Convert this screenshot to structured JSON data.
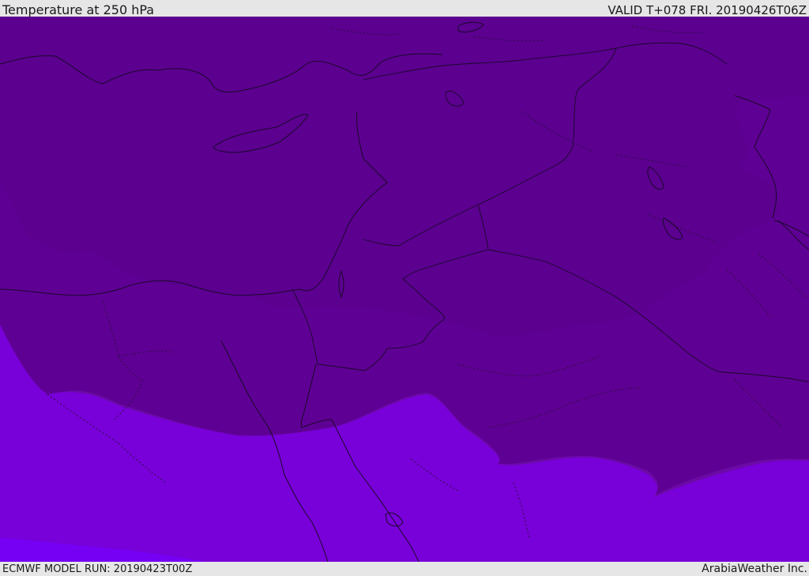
{
  "header": {
    "title": "Temperature at 250 hPa",
    "valid": "VALID T+078 FRI. 20190426T06Z"
  },
  "footer": {
    "model_run": "ECMWF MODEL RUN: 20190423T00Z",
    "credit": "ArabiaWeather Inc."
  },
  "map": {
    "field": "temperature",
    "level": "250 hPa",
    "color_bands": [
      "#520078",
      "#5f0094",
      "#6b0aa6",
      "#7812b8",
      "#7800d8",
      "#7500f4"
    ]
  }
}
